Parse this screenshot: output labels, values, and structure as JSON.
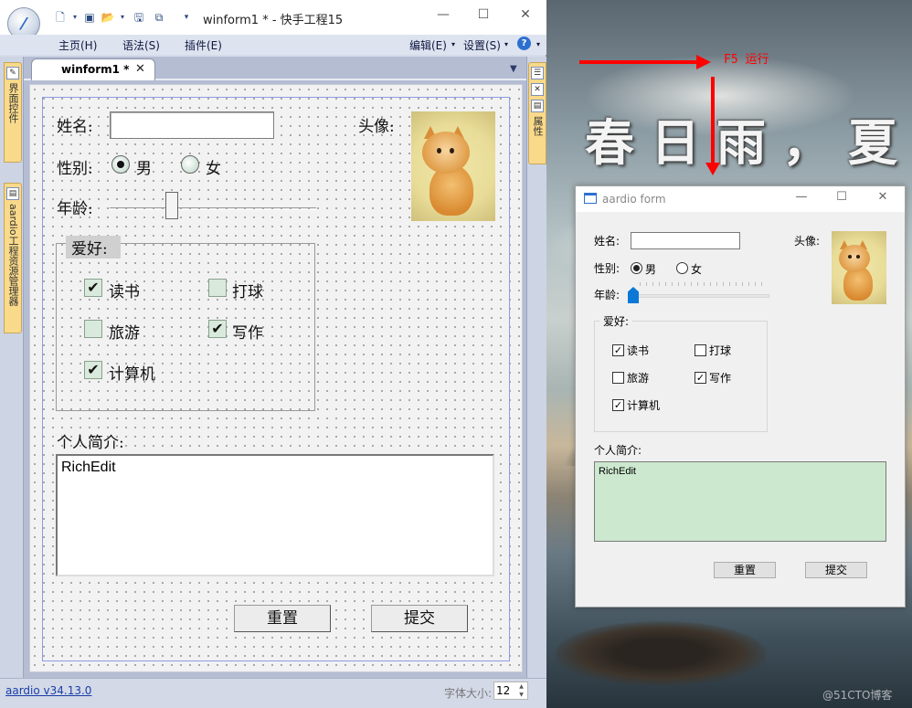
{
  "ide": {
    "title": "winform1 * - 快手工程15",
    "menu": [
      "主页(H)",
      "语法(S)",
      "插件(E)"
    ],
    "menu_right": [
      "编辑(E)",
      "设置(S)"
    ],
    "doc_tab": "winform1 *",
    "left_tabs": [
      "界面控件",
      "aardio工程资源管理器"
    ],
    "right_tabs": [
      "属性"
    ],
    "status": {
      "version": "aardio v34.13.0",
      "font_size_label": "字体大小:",
      "font_size_value": "12"
    }
  },
  "designer": {
    "name_label": "姓名:",
    "avatar_label": "头像:",
    "gender_label": "性别:",
    "gender_options": [
      "男",
      "女"
    ],
    "age_label": "年龄:",
    "age_value_fraction": 0.3,
    "hobbies_label": "爱好:",
    "hobbies": [
      {
        "label": "读书",
        "checked": true
      },
      {
        "label": "打球",
        "checked": false
      },
      {
        "label": "旅游",
        "checked": false
      },
      {
        "label": "写作",
        "checked": true
      },
      {
        "label": "计算机",
        "checked": true
      }
    ],
    "bio_label": "个人简介:",
    "rich_text": "RichEdit",
    "reset_button": "重置",
    "submit_button": "提交"
  },
  "annotation": {
    "run_label": "F5 运行",
    "color": "#ff0000"
  },
  "form": {
    "title": "aardio form",
    "name_label": "姓名:",
    "avatar_label": "头像:",
    "gender_label": "性别:",
    "gender_options": [
      "男",
      "女"
    ],
    "age_label": "年龄:",
    "age_value_fraction": 0,
    "hobbies_label": "爱好:",
    "hobbies": [
      {
        "label": "读书",
        "checked": true
      },
      {
        "label": "打球",
        "checked": false
      },
      {
        "label": "旅游",
        "checked": false
      },
      {
        "label": "写作",
        "checked": true
      },
      {
        "label": "计算机",
        "checked": true
      }
    ],
    "bio_label": "个人简介:",
    "rich_text": "RichEdit",
    "rich_bg": "#cce8cf",
    "reset_button": "重置",
    "submit_button": "提交"
  },
  "background": {
    "poem": "春日雨，夏",
    "watermark": "@51CTO博客"
  }
}
